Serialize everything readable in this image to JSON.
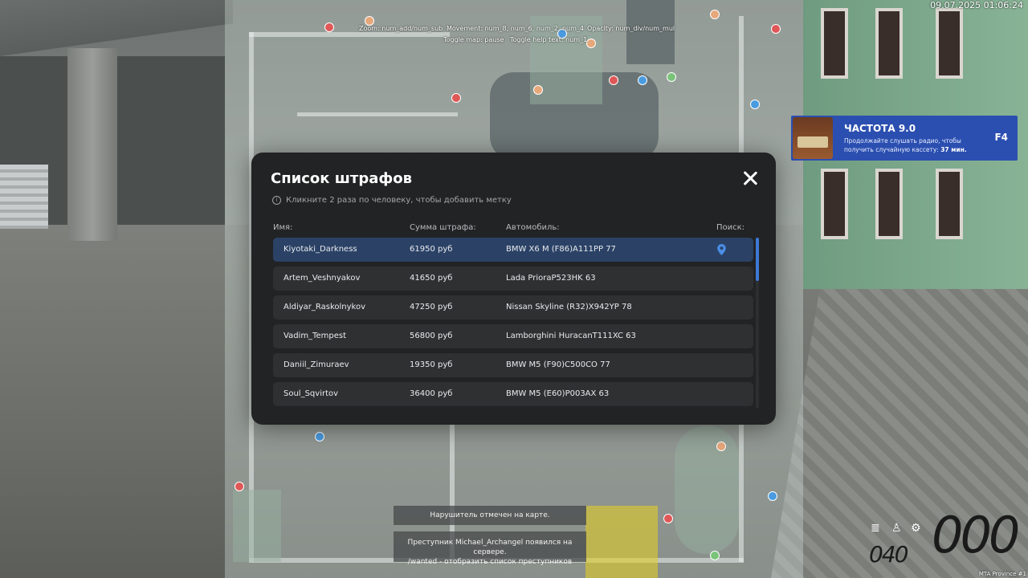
{
  "timestamp": "09.07.2025 01:06:24",
  "map_hints": {
    "zoom": "Zoom: num_add/num_sub",
    "movement": "Movement: num_8, num_6, num_2, num_4",
    "opacity": "Opacity: num_div/num_mul",
    "toggle_map": "Toggle map: pause",
    "toggle_help": "Toggle help text: num_1"
  },
  "radio": {
    "title": "ЧАСТОТА 9.0",
    "text_prefix": "Продолжайте слушать радио, чтобы получить случайную кассету:",
    "time": "37 мин.",
    "key": "F4"
  },
  "modal": {
    "title": "Список штрафов",
    "info": "Кликните 2 раза по человеку, чтобы добавить метку",
    "columns": {
      "name": "Имя:",
      "amount": "Сумма штрафа:",
      "car": "Автомобиль:",
      "search": "Поиск:"
    },
    "rows": [
      {
        "name": "Kiyotaki_Darkness",
        "amount": "61950 руб",
        "car": "BMW X6 M (F86)A111PP 77"
      },
      {
        "name": "Artem_Veshnyakov",
        "amount": "41650 руб",
        "car": "Lada PrioraP523HK 63"
      },
      {
        "name": "Aldiyar_Raskolnykov",
        "amount": "47250 руб",
        "car": "Nissan Skyline (R32)X942YP 78"
      },
      {
        "name": "Vadim_Tempest",
        "amount": "56800 руб",
        "car": "Lamborghini HuracanT111XC 63"
      },
      {
        "name": "Daniil_Zimuraev",
        "amount": "19350 руб",
        "car": "BMW M5 (F90)C500CO 77"
      },
      {
        "name": "Soul_Sqvirtov",
        "amount": "36400 руб",
        "car": "BMW M5 (E60)P003AX 63"
      }
    ]
  },
  "notifications": {
    "marked": "Нарушитель отмечен на карте.",
    "criminal_line1": "Преступник Michael_Archangel появился на сервере.",
    "criminal_line2": "/wanted - отобразить список преступников"
  },
  "hud": {
    "speed": "000",
    "fuel": "040",
    "server": "MTA Province #1"
  },
  "colors": {
    "modal_bg": "#222324",
    "row_bg": "#2f3032",
    "row_active": "#2b4266",
    "accent": "#3d78d6",
    "radio_bg": "#2b4fb0"
  }
}
